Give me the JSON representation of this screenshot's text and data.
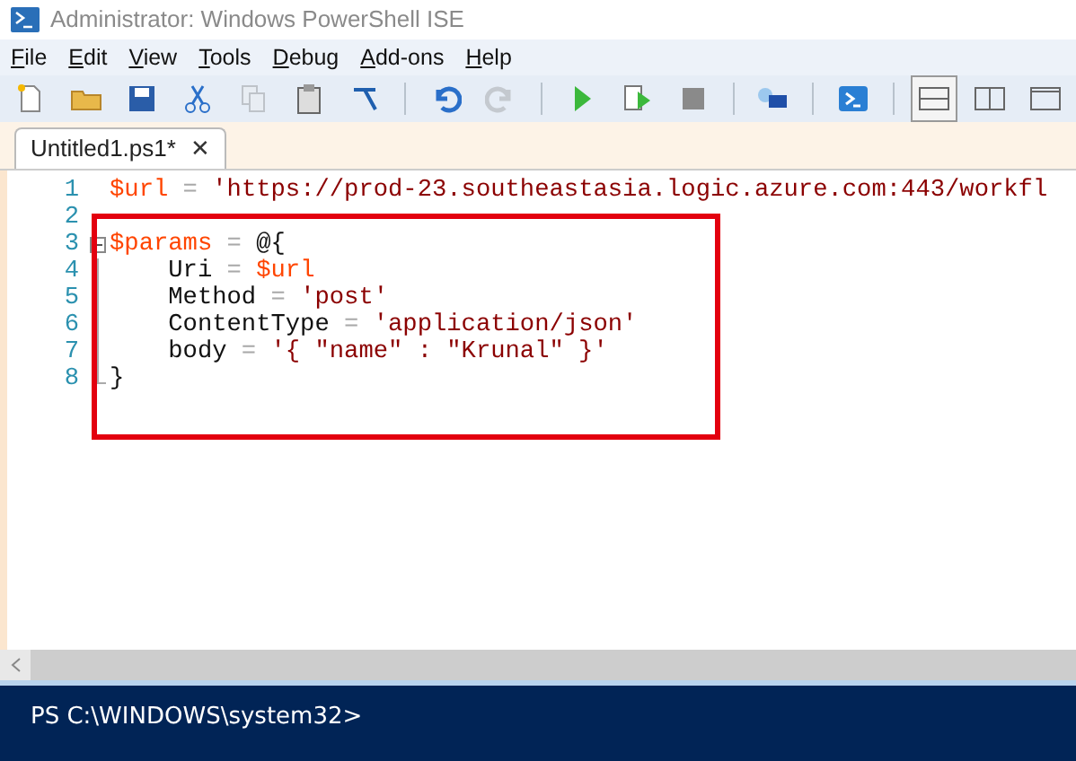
{
  "window": {
    "title": "Administrator: Windows PowerShell ISE"
  },
  "menu": [
    "File",
    "Edit",
    "View",
    "Tools",
    "Debug",
    "Add-ons",
    "Help"
  ],
  "toolbar": [
    {
      "kind": "new",
      "disabled": false
    },
    {
      "kind": "open",
      "disabled": false
    },
    {
      "kind": "save",
      "disabled": false
    },
    {
      "kind": "cut",
      "disabled": false
    },
    {
      "kind": "copy",
      "disabled": true
    },
    {
      "kind": "paste",
      "disabled": false
    },
    {
      "kind": "clear",
      "disabled": false
    },
    {
      "kind": "sep"
    },
    {
      "kind": "undo",
      "disabled": false
    },
    {
      "kind": "redo",
      "disabled": true
    },
    {
      "kind": "sep"
    },
    {
      "kind": "run",
      "disabled": false
    },
    {
      "kind": "runsel",
      "disabled": false
    },
    {
      "kind": "stop",
      "disabled": true
    },
    {
      "kind": "sep"
    },
    {
      "kind": "remote",
      "disabled": false
    },
    {
      "kind": "sep"
    },
    {
      "kind": "console",
      "disabled": false
    },
    {
      "kind": "sep"
    },
    {
      "kind": "layout-top",
      "selected": true
    },
    {
      "kind": "layout-right",
      "selected": false
    },
    {
      "kind": "layout-max",
      "selected": false
    }
  ],
  "tabs": [
    {
      "label": "Untitled1.ps1*",
      "selected": true,
      "close": "✕"
    }
  ],
  "editor": {
    "lines": [
      {
        "number": "1",
        "kind": "plain",
        "tokens": [
          {
            "kind": "var",
            "text": "$url"
          },
          {
            "kind": "op",
            "text": " = "
          },
          {
            "kind": "str",
            "text": "'https://prod-23.southeastasia.logic.azure.com:443/workfl"
          }
        ]
      },
      {
        "number": "2",
        "kind": "plain"
      },
      {
        "number": "3",
        "kind": "fold-start",
        "tokens": [
          {
            "kind": "var",
            "text": "$params"
          },
          {
            "kind": "op",
            "text": " = "
          },
          {
            "kind": "plain",
            "text": "@{"
          }
        ]
      },
      {
        "number": "4",
        "kind": "fold-body",
        "tokens": [
          {
            "kind": "plain",
            "text": "    Uri"
          },
          {
            "kind": "op",
            "text": " = "
          },
          {
            "kind": "var",
            "text": "$url"
          }
        ]
      },
      {
        "number": "5",
        "kind": "fold-body",
        "tokens": [
          {
            "kind": "plain",
            "text": "    Method"
          },
          {
            "kind": "op",
            "text": " = "
          },
          {
            "kind": "str",
            "text": "'post'"
          }
        ]
      },
      {
        "number": "6",
        "kind": "fold-body",
        "tokens": [
          {
            "kind": "plain",
            "text": "    ContentType"
          },
          {
            "kind": "op",
            "text": " = "
          },
          {
            "kind": "str",
            "text": "'application/json'"
          }
        ]
      },
      {
        "number": "7",
        "kind": "fold-body",
        "tokens": [
          {
            "kind": "plain",
            "text": "    body"
          },
          {
            "kind": "op",
            "text": " = "
          },
          {
            "kind": "str",
            "text": "'{ \"name\" : \"Krunal\" }'"
          }
        ]
      },
      {
        "number": "8",
        "kind": "fold-end",
        "tokens": [
          {
            "kind": "plain",
            "text": "}"
          }
        ]
      }
    ]
  },
  "console": {
    "prompt": "PS C:\\WINDOWS\\system32>"
  }
}
